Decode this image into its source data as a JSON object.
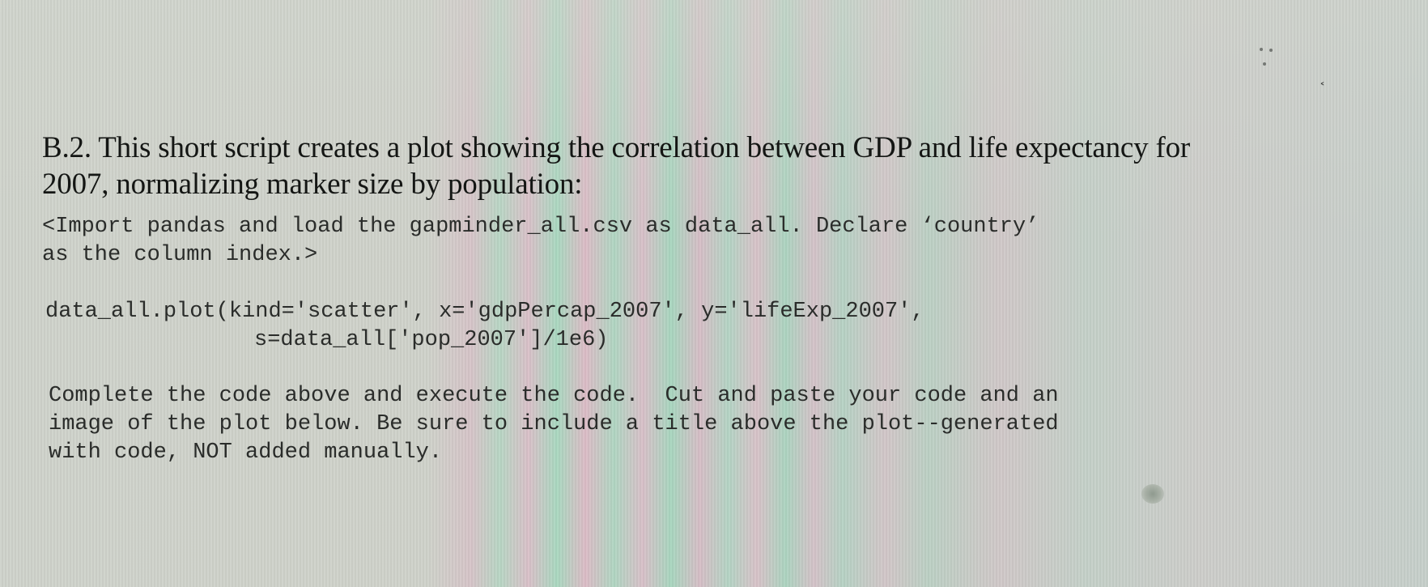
{
  "question": {
    "heading_line1": "B.2. This short script creates a plot showing the correlation between GDP and life expectancy for",
    "heading_line2": "2007, normalizing marker size by population:",
    "import_line1": "<Import pandas and load the gapminder_all.csv as data_all. Declare ‘country’",
    "import_line2": "as the column index.>",
    "code_line1": "data_all.plot(kind='scatter', x='gdpPercap_2007', y='lifeExp_2007',",
    "code_line2": "s=data_all['pop_2007']/1e6)",
    "instruction_line1": "Complete the code above and execute the code.  Cut and paste your code and an",
    "instruction_line2": "image of the plot below. Be sure to include a title above the plot--generated",
    "instruction_line3": "with code, NOT added manually."
  },
  "screen": {
    "cursor_icon": "mouse-cursor-icon",
    "cursor_glyph": "˂"
  }
}
